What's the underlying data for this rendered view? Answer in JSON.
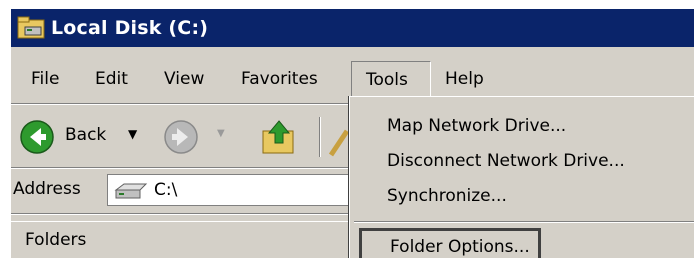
{
  "window": {
    "title": "Local Disk (C:)",
    "title_icon": "folder-drive-icon"
  },
  "menubar": {
    "items": [
      {
        "label": "File"
      },
      {
        "label": "Edit"
      },
      {
        "label": "View"
      },
      {
        "label": "Favorites"
      },
      {
        "label": "Tools"
      },
      {
        "label": "Help"
      }
    ]
  },
  "toolbar": {
    "back_label": "Back",
    "back_icon": "back-arrow-icon",
    "forward_icon": "forward-arrow-icon",
    "up_icon": "up-folder-icon"
  },
  "address": {
    "label": "Address",
    "value": "C:\\",
    "icon": "drive-icon"
  },
  "folders_pane": {
    "label": "Folders"
  },
  "tools_menu": {
    "items": [
      {
        "label": "Map Network Drive..."
      },
      {
        "label": "Disconnect Network Drive..."
      },
      {
        "label": "Synchronize..."
      }
    ],
    "focused_item": {
      "label": "Folder Options..."
    }
  },
  "colors": {
    "titlebar": "#0a246a",
    "chrome": "#d4d0c8"
  }
}
